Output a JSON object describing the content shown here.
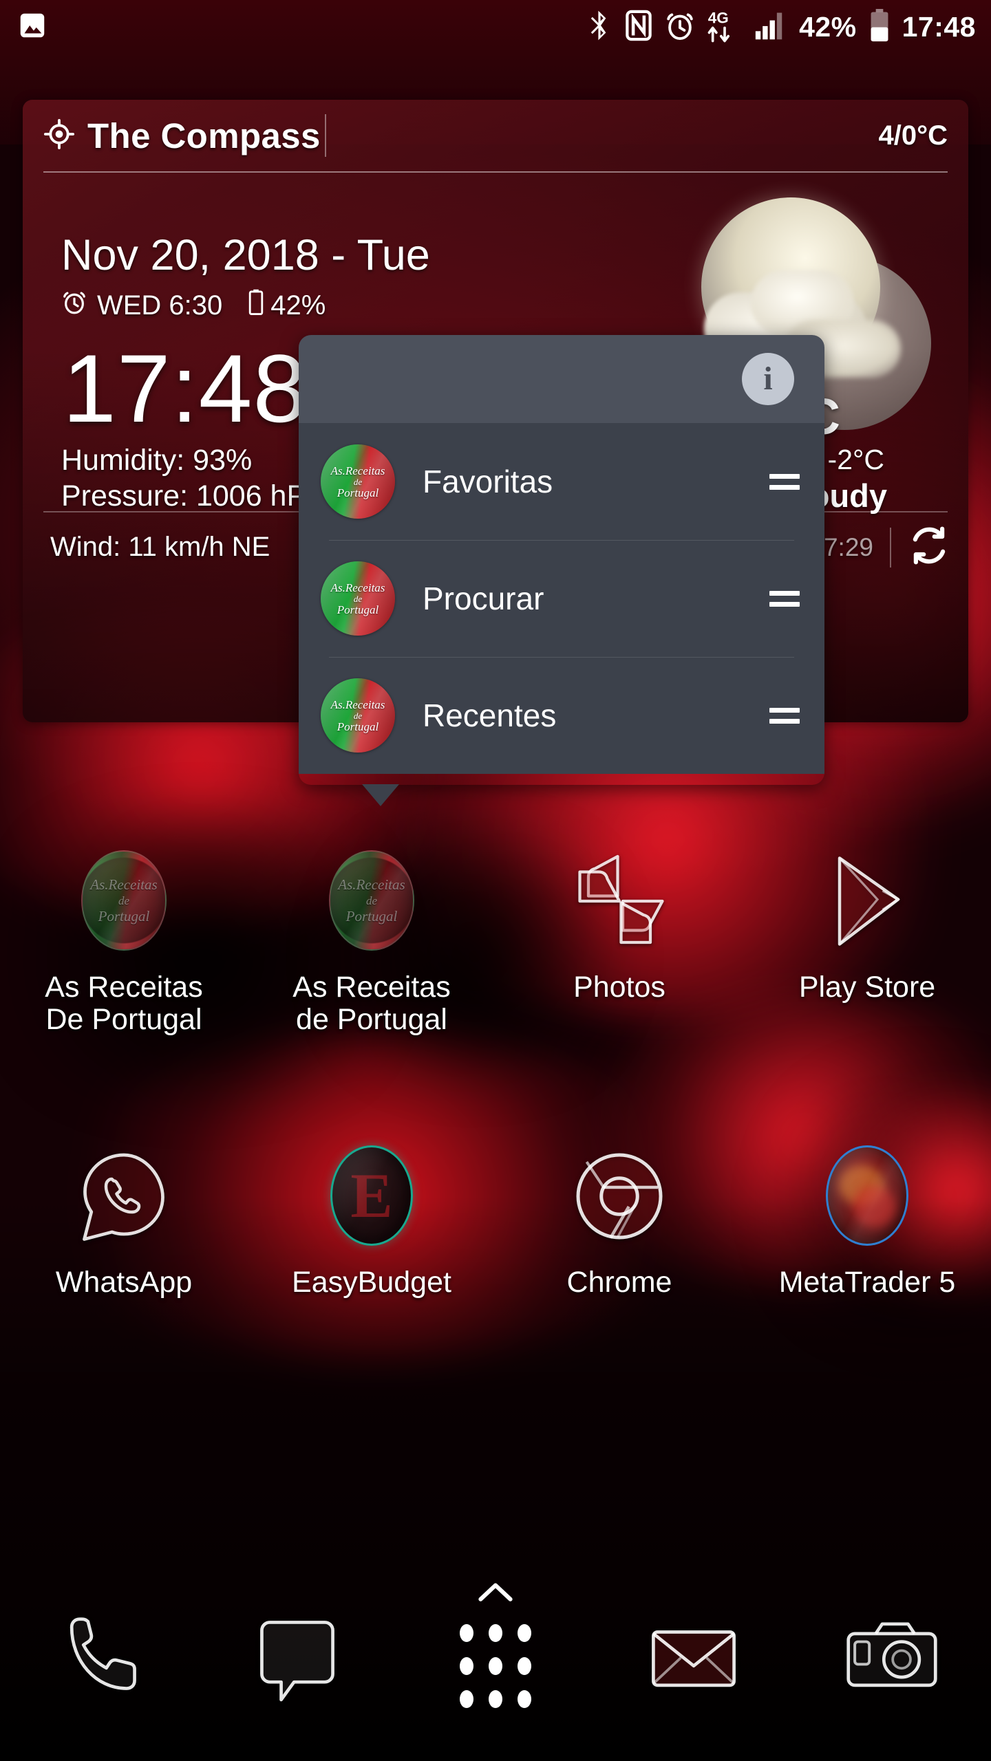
{
  "statusbar": {
    "left_icons": [
      "image-icon"
    ],
    "right_icons": [
      "bluetooth-icon",
      "nfc-icon",
      "alarm-icon",
      "4g-data-icon",
      "signal-icon",
      "battery-icon"
    ],
    "battery_percent": "42%",
    "clock": "17:48"
  },
  "widget": {
    "title": "The Compass",
    "location_icon": "location-icon",
    "temp_highlow": "4/0°C",
    "date": "Nov 20, 2018 - Tue",
    "alarm_icon": "alarm-icon",
    "alarm": "WED 6:30",
    "battery_icon": "battery-icon",
    "battery": "42%",
    "clock": "17:48",
    "humidity": "Humidity: 93%",
    "pressure": "Pressure: 1006 hPa",
    "current_temp": "2°C",
    "feels_like": "Feels Like: -2°C",
    "condition": "Partly Cloudy",
    "wind": "Wind: 11 km/h NE",
    "updated": "Nov 20  17:29",
    "refresh_icon": "refresh-icon",
    "weather_icon": "moon-cloud-icon"
  },
  "popup": {
    "info_icon": "info-icon",
    "info_label": "i",
    "items": [
      {
        "label": "Favoritas",
        "icon": "as-receitas-de-portugal-icon",
        "handle": "drag-handle-icon",
        "icon_text": {
          "l1": "As.Receitas",
          "l2": "de",
          "l3": "Portugal"
        }
      },
      {
        "label": "Procurar",
        "icon": "as-receitas-de-portugal-icon",
        "handle": "drag-handle-icon",
        "icon_text": {
          "l1": "As.Receitas",
          "l2": "de",
          "l3": "Portugal"
        }
      },
      {
        "label": "Recentes",
        "icon": "as-receitas-de-portugal-icon",
        "handle": "drag-handle-icon",
        "icon_text": {
          "l1": "As.Receitas",
          "l2": "de",
          "l3": "Portugal"
        }
      }
    ]
  },
  "apps": {
    "row1": [
      {
        "name": "app-as-receitas-de-portugal-1",
        "line1": "As Receitas",
        "line2": "De Portugal",
        "icon": "as-receitas-de-portugal-icon"
      },
      {
        "name": "app-as-receitas-de-portugal-2",
        "line1": "As Receitas",
        "line2": "de Portugal",
        "icon": "as-receitas-de-portugal-icon"
      },
      {
        "name": "app-photos",
        "line1": "Photos",
        "line2": "",
        "icon": "photos-icon"
      },
      {
        "name": "app-play-store",
        "line1": "Play Store",
        "line2": "",
        "icon": "play-store-icon"
      }
    ],
    "row2": [
      {
        "name": "app-whatsapp",
        "line1": "WhatsApp",
        "line2": "",
        "icon": "whatsapp-icon"
      },
      {
        "name": "app-easybudget",
        "line1": "EasyBudget",
        "line2": "",
        "icon": "easybudget-icon"
      },
      {
        "name": "app-chrome",
        "line1": "Chrome",
        "line2": "",
        "icon": "chrome-icon"
      },
      {
        "name": "app-metatrader5",
        "line1": "MetaTrader 5",
        "line2": "",
        "icon": "metatrader-icon"
      }
    ]
  },
  "dock": {
    "items": [
      {
        "name": "dock-phone",
        "icon": "phone-icon"
      },
      {
        "name": "dock-messages",
        "icon": "message-bubble-icon"
      },
      {
        "name": "dock-app-drawer",
        "icon": "app-drawer-icon"
      },
      {
        "name": "dock-email",
        "icon": "envelope-icon"
      },
      {
        "name": "dock-camera",
        "icon": "camera-icon"
      }
    ]
  },
  "colors": {
    "wallpaper_red": "#9e0c14",
    "widget_tint": "#67121a",
    "popup_header": "#4c515c",
    "popup_body": "#3c414b",
    "accent_white": "#ffffff",
    "easybudget_teal": "#18a98f",
    "metatrader_blue": "#2f7fd1",
    "portugal_green": "#15a331",
    "portugal_red": "#c8161d"
  }
}
